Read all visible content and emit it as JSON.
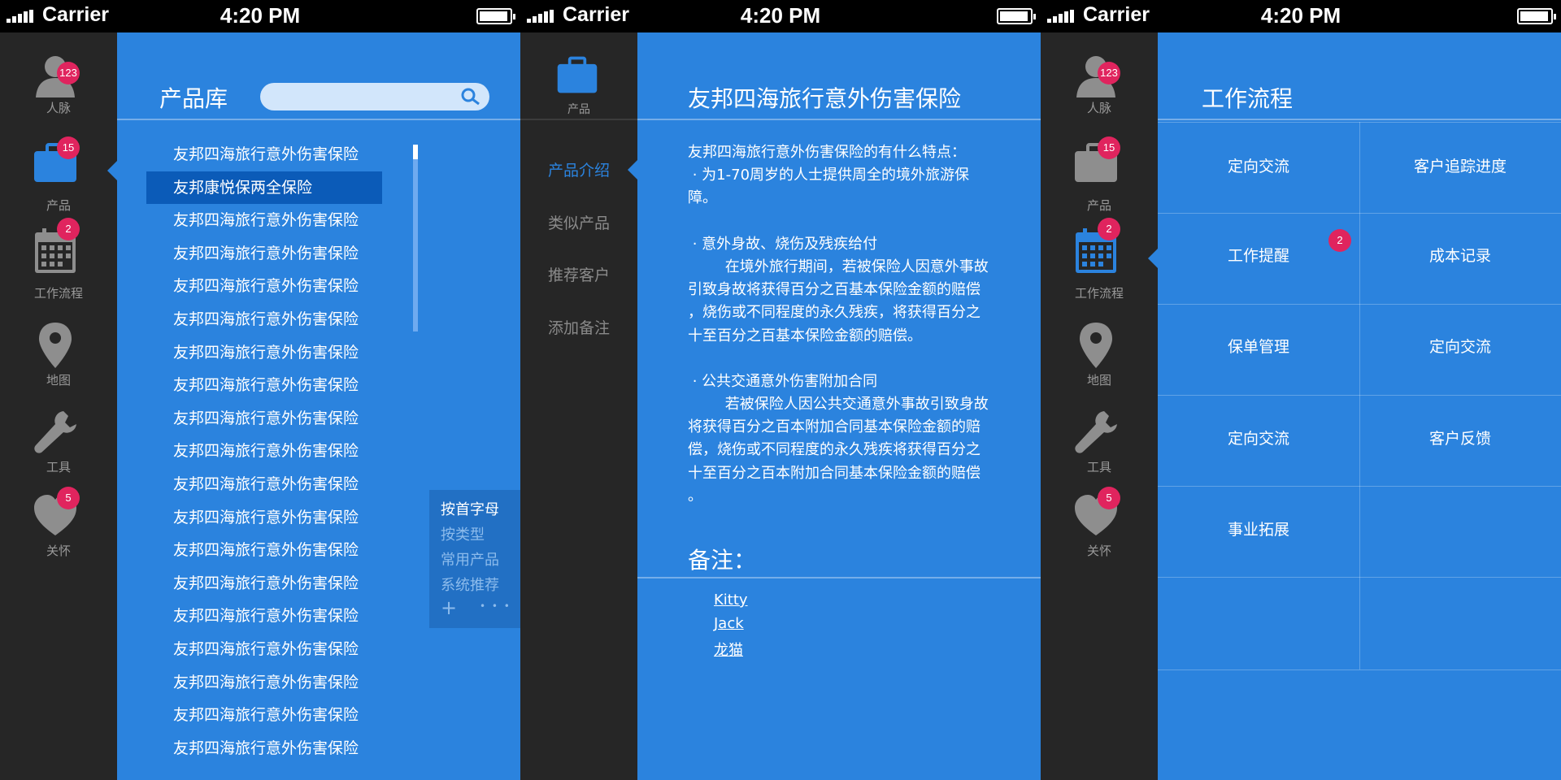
{
  "status_bar": {
    "carrier": "Carrier",
    "time": "4:20 PM"
  },
  "sidebar": {
    "items": [
      {
        "label": "人脉",
        "badge": "123",
        "icon": "person-icon"
      },
      {
        "label": "产品",
        "badge": "15",
        "icon": "briefcase-icon"
      },
      {
        "label": "工作流程",
        "badge": "2",
        "icon": "calendar-icon"
      },
      {
        "label": "地图",
        "badge": "",
        "icon": "map-pin-icon"
      },
      {
        "label": "工具",
        "badge": "",
        "icon": "wrench-icon"
      },
      {
        "label": "关怀",
        "badge": "5",
        "icon": "heart-icon"
      }
    ]
  },
  "product_library": {
    "title": "产品库",
    "search_placeholder": "",
    "items": [
      "友邦四海旅行意外伤害保险",
      "友邦康悦保两全保险",
      "友邦四海旅行意外伤害保险",
      "友邦四海旅行意外伤害保险",
      "友邦四海旅行意外伤害保险",
      "友邦四海旅行意外伤害保险",
      "友邦四海旅行意外伤害保险",
      "友邦四海旅行意外伤害保险",
      "友邦四海旅行意外伤害保险",
      "友邦四海旅行意外伤害保险",
      "友邦四海旅行意外伤害保险",
      "友邦四海旅行意外伤害保险",
      "友邦四海旅行意外伤害保险",
      "友邦四海旅行意外伤害保险",
      "友邦四海旅行意外伤害保险",
      "友邦四海旅行意外伤害保险",
      "友邦四海旅行意外伤害保险",
      "友邦四海旅行意外伤害保险",
      "友邦四海旅行意外伤害保险"
    ],
    "selected_index": 1,
    "sort_options": [
      "按首字母",
      "按类型",
      "常用产品",
      "系统推荐"
    ],
    "sort_actions": {
      "add": "+",
      "more": "• • •"
    }
  },
  "product_detail": {
    "sidebar_label": "产品",
    "nav": [
      "产品介绍",
      "类似产品",
      "推荐客户",
      "添加备注"
    ],
    "title": "友邦四海旅行意外伤害保险",
    "content_lines": [
      "友邦四海旅行意外伤害保险的有什么特点：",
      " · 为1-70周岁的人士提供周全的境外旅游保",
      "障。",
      "",
      " · 意外身故、烧伤及残疾给付",
      "        在境外旅行期间，若被保险人因意外事故",
      "引致身故将获得百分之百基本保险金额的赔偿",
      "，烧伤或不同程度的永久残疾，将获得百分之",
      "十至百分之百基本保险金额的赔偿。",
      "",
      " · 公共交通意外伤害附加合同",
      "        若被保险人因公共交通意外事故引致身故",
      "将获得百分之百本附加合同基本保险金额的赔",
      "偿，烧伤或不同程度的永久残疾将获得百分之",
      "十至百分之百本附加合同基本保险金额的赔偿",
      "。"
    ],
    "notes_title": "备注：",
    "notes": [
      "Kitty",
      "Jack",
      "龙猫"
    ]
  },
  "workflow": {
    "title": "工作流程",
    "grid": [
      {
        "label": "定向交流",
        "badge": ""
      },
      {
        "label": "客户追踪进度",
        "badge": ""
      },
      {
        "label": "工作提醒",
        "badge": "2"
      },
      {
        "label": "成本记录",
        "badge": ""
      },
      {
        "label": "保单管理",
        "badge": ""
      },
      {
        "label": "定向交流",
        "badge": ""
      },
      {
        "label": "定向交流",
        "badge": ""
      },
      {
        "label": "客户反馈",
        "badge": ""
      },
      {
        "label": "事业拓展",
        "badge": ""
      },
      {
        "label": "",
        "badge": ""
      },
      {
        "label": "",
        "badge": ""
      },
      {
        "label": "",
        "badge": ""
      }
    ]
  },
  "colors": {
    "accent": "#2b83de",
    "sidebar": "#262626",
    "badge": "#e0245e",
    "selected": "#0b5bb8"
  }
}
